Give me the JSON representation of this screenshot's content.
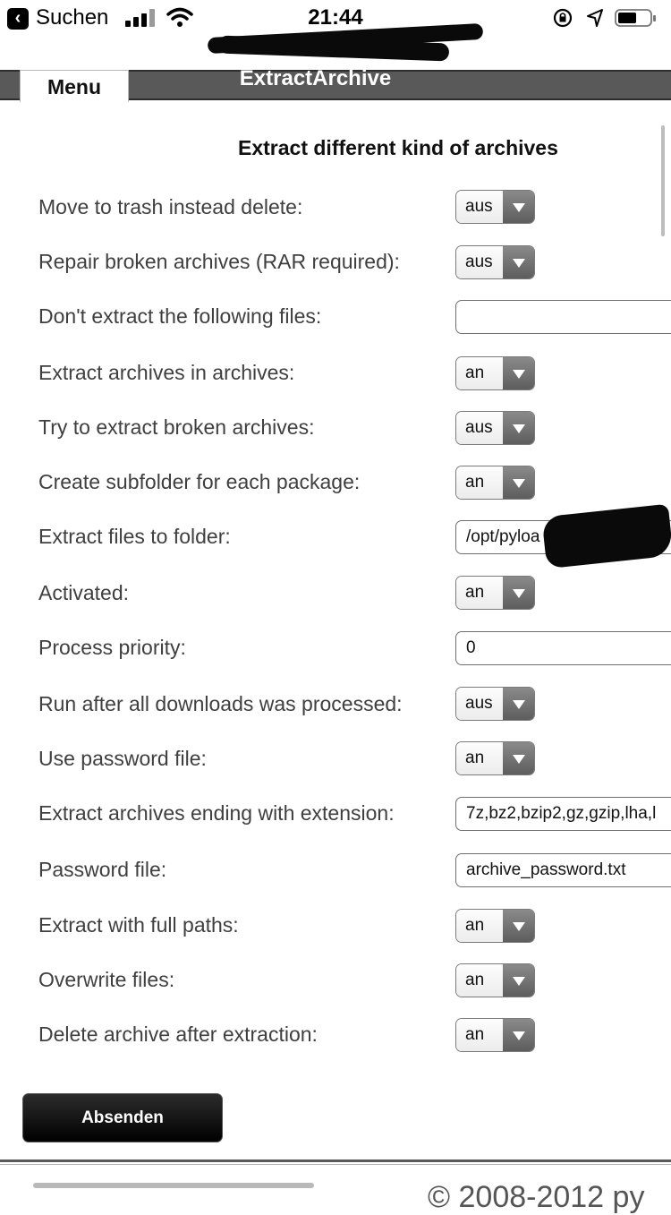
{
  "status_bar": {
    "back_app": "Suchen",
    "time": "21:44",
    "back_icon": "chevron-left-icon",
    "signal_icon": "cellular-signal-icon",
    "wifi_icon": "wifi-icon",
    "rotation_lock_icon": "rotation-lock-icon",
    "location_icon": "location-arrow-icon",
    "battery_icon": "battery-icon"
  },
  "header": {
    "menu_tab": "Menu",
    "title": "ExtractArchive"
  },
  "form": {
    "heading": "Extract different kind of archives",
    "rows": [
      {
        "label": "Move to trash instead delete:",
        "type": "select",
        "value": "aus"
      },
      {
        "label": "Repair broken archives (RAR required):",
        "type": "select",
        "value": "aus"
      },
      {
        "label": "Don't extract the following files:",
        "type": "text",
        "value": ""
      },
      {
        "label": "Extract archives in archives:",
        "type": "select",
        "value": "an"
      },
      {
        "label": "Try to extract broken archives:",
        "type": "select",
        "value": "aus"
      },
      {
        "label": "Create subfolder for each package:",
        "type": "select",
        "value": "an"
      },
      {
        "label": "Extract files to folder:",
        "type": "text",
        "value": "/opt/pyloa"
      },
      {
        "label": "Activated:",
        "type": "select",
        "value": "an"
      },
      {
        "label": "Process priority:",
        "type": "text",
        "value": "0"
      },
      {
        "label": "Run after all downloads was processed:",
        "type": "select",
        "value": "aus"
      },
      {
        "label": "Use password file:",
        "type": "select",
        "value": "an"
      },
      {
        "label": "Extract archives ending with extension:",
        "type": "text",
        "value": "7z,bz2,bzip2,gz,gzip,lha,l"
      },
      {
        "label": "Password file:",
        "type": "text",
        "value": "archive_password.txt"
      },
      {
        "label": "Extract with full paths:",
        "type": "select",
        "value": "an"
      },
      {
        "label": "Overwrite files:",
        "type": "select",
        "value": "an"
      },
      {
        "label": "Delete archive after extraction:",
        "type": "select",
        "value": "an"
      }
    ],
    "submit_label": "Absenden"
  },
  "footer": {
    "copyright": "© 2008-2012 py"
  }
}
